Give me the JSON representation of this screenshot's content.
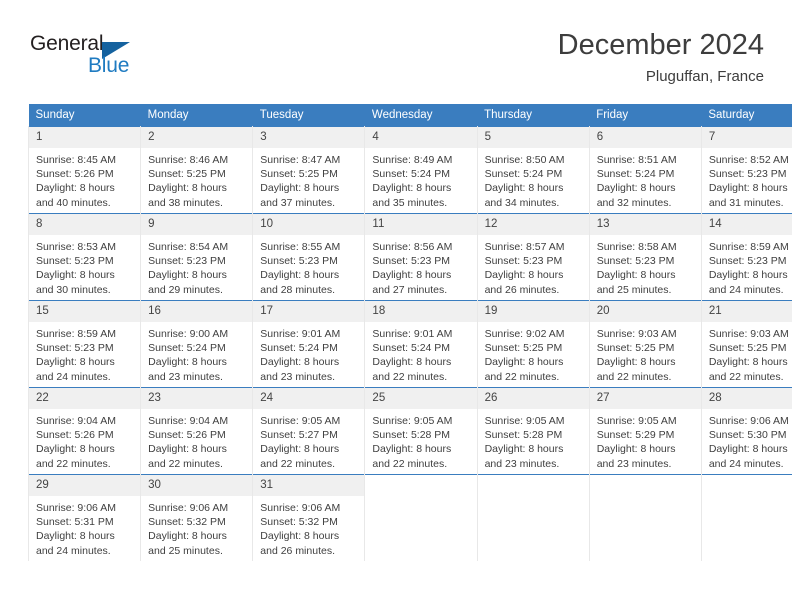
{
  "brand": {
    "name_part1": "General",
    "name_part2": "Blue",
    "triangle_color": "#15629f",
    "blue_color": "#1f7bc1"
  },
  "header": {
    "title": "December 2024",
    "location": "Pluguffan, France"
  },
  "theme": {
    "header_bg": "#3a7dbf",
    "daynum_bg": "#f0f0f0",
    "text_color": "#3f3f3f"
  },
  "weekdays": [
    "Sunday",
    "Monday",
    "Tuesday",
    "Wednesday",
    "Thursday",
    "Friday",
    "Saturday"
  ],
  "labels": {
    "sunrise_prefix": "Sunrise: ",
    "sunset_prefix": "Sunset: ",
    "daylight_prefix": "Daylight: "
  },
  "weeks": [
    [
      {
        "day": "1",
        "sunrise": "Sunrise: 8:45 AM",
        "sunset": "Sunset: 5:26 PM",
        "daylight_line1": "Daylight: 8 hours",
        "daylight_line2": "and 40 minutes."
      },
      {
        "day": "2",
        "sunrise": "Sunrise: 8:46 AM",
        "sunset": "Sunset: 5:25 PM",
        "daylight_line1": "Daylight: 8 hours",
        "daylight_line2": "and 38 minutes."
      },
      {
        "day": "3",
        "sunrise": "Sunrise: 8:47 AM",
        "sunset": "Sunset: 5:25 PM",
        "daylight_line1": "Daylight: 8 hours",
        "daylight_line2": "and 37 minutes."
      },
      {
        "day": "4",
        "sunrise": "Sunrise: 8:49 AM",
        "sunset": "Sunset: 5:24 PM",
        "daylight_line1": "Daylight: 8 hours",
        "daylight_line2": "and 35 minutes."
      },
      {
        "day": "5",
        "sunrise": "Sunrise: 8:50 AM",
        "sunset": "Sunset: 5:24 PM",
        "daylight_line1": "Daylight: 8 hours",
        "daylight_line2": "and 34 minutes."
      },
      {
        "day": "6",
        "sunrise": "Sunrise: 8:51 AM",
        "sunset": "Sunset: 5:24 PM",
        "daylight_line1": "Daylight: 8 hours",
        "daylight_line2": "and 32 minutes."
      },
      {
        "day": "7",
        "sunrise": "Sunrise: 8:52 AM",
        "sunset": "Sunset: 5:23 PM",
        "daylight_line1": "Daylight: 8 hours",
        "daylight_line2": "and 31 minutes."
      }
    ],
    [
      {
        "day": "8",
        "sunrise": "Sunrise: 8:53 AM",
        "sunset": "Sunset: 5:23 PM",
        "daylight_line1": "Daylight: 8 hours",
        "daylight_line2": "and 30 minutes."
      },
      {
        "day": "9",
        "sunrise": "Sunrise: 8:54 AM",
        "sunset": "Sunset: 5:23 PM",
        "daylight_line1": "Daylight: 8 hours",
        "daylight_line2": "and 29 minutes."
      },
      {
        "day": "10",
        "sunrise": "Sunrise: 8:55 AM",
        "sunset": "Sunset: 5:23 PM",
        "daylight_line1": "Daylight: 8 hours",
        "daylight_line2": "and 28 minutes."
      },
      {
        "day": "11",
        "sunrise": "Sunrise: 8:56 AM",
        "sunset": "Sunset: 5:23 PM",
        "daylight_line1": "Daylight: 8 hours",
        "daylight_line2": "and 27 minutes."
      },
      {
        "day": "12",
        "sunrise": "Sunrise: 8:57 AM",
        "sunset": "Sunset: 5:23 PM",
        "daylight_line1": "Daylight: 8 hours",
        "daylight_line2": "and 26 minutes."
      },
      {
        "day": "13",
        "sunrise": "Sunrise: 8:58 AM",
        "sunset": "Sunset: 5:23 PM",
        "daylight_line1": "Daylight: 8 hours",
        "daylight_line2": "and 25 minutes."
      },
      {
        "day": "14",
        "sunrise": "Sunrise: 8:59 AM",
        "sunset": "Sunset: 5:23 PM",
        "daylight_line1": "Daylight: 8 hours",
        "daylight_line2": "and 24 minutes."
      }
    ],
    [
      {
        "day": "15",
        "sunrise": "Sunrise: 8:59 AM",
        "sunset": "Sunset: 5:23 PM",
        "daylight_line1": "Daylight: 8 hours",
        "daylight_line2": "and 24 minutes."
      },
      {
        "day": "16",
        "sunrise": "Sunrise: 9:00 AM",
        "sunset": "Sunset: 5:24 PM",
        "daylight_line1": "Daylight: 8 hours",
        "daylight_line2": "and 23 minutes."
      },
      {
        "day": "17",
        "sunrise": "Sunrise: 9:01 AM",
        "sunset": "Sunset: 5:24 PM",
        "daylight_line1": "Daylight: 8 hours",
        "daylight_line2": "and 23 minutes."
      },
      {
        "day": "18",
        "sunrise": "Sunrise: 9:01 AM",
        "sunset": "Sunset: 5:24 PM",
        "daylight_line1": "Daylight: 8 hours",
        "daylight_line2": "and 22 minutes."
      },
      {
        "day": "19",
        "sunrise": "Sunrise: 9:02 AM",
        "sunset": "Sunset: 5:25 PM",
        "daylight_line1": "Daylight: 8 hours",
        "daylight_line2": "and 22 minutes."
      },
      {
        "day": "20",
        "sunrise": "Sunrise: 9:03 AM",
        "sunset": "Sunset: 5:25 PM",
        "daylight_line1": "Daylight: 8 hours",
        "daylight_line2": "and 22 minutes."
      },
      {
        "day": "21",
        "sunrise": "Sunrise: 9:03 AM",
        "sunset": "Sunset: 5:25 PM",
        "daylight_line1": "Daylight: 8 hours",
        "daylight_line2": "and 22 minutes."
      }
    ],
    [
      {
        "day": "22",
        "sunrise": "Sunrise: 9:04 AM",
        "sunset": "Sunset: 5:26 PM",
        "daylight_line1": "Daylight: 8 hours",
        "daylight_line2": "and 22 minutes."
      },
      {
        "day": "23",
        "sunrise": "Sunrise: 9:04 AM",
        "sunset": "Sunset: 5:26 PM",
        "daylight_line1": "Daylight: 8 hours",
        "daylight_line2": "and 22 minutes."
      },
      {
        "day": "24",
        "sunrise": "Sunrise: 9:05 AM",
        "sunset": "Sunset: 5:27 PM",
        "daylight_line1": "Daylight: 8 hours",
        "daylight_line2": "and 22 minutes."
      },
      {
        "day": "25",
        "sunrise": "Sunrise: 9:05 AM",
        "sunset": "Sunset: 5:28 PM",
        "daylight_line1": "Daylight: 8 hours",
        "daylight_line2": "and 22 minutes."
      },
      {
        "day": "26",
        "sunrise": "Sunrise: 9:05 AM",
        "sunset": "Sunset: 5:28 PM",
        "daylight_line1": "Daylight: 8 hours",
        "daylight_line2": "and 23 minutes."
      },
      {
        "day": "27",
        "sunrise": "Sunrise: 9:05 AM",
        "sunset": "Sunset: 5:29 PM",
        "daylight_line1": "Daylight: 8 hours",
        "daylight_line2": "and 23 minutes."
      },
      {
        "day": "28",
        "sunrise": "Sunrise: 9:06 AM",
        "sunset": "Sunset: 5:30 PM",
        "daylight_line1": "Daylight: 8 hours",
        "daylight_line2": "and 24 minutes."
      }
    ],
    [
      {
        "day": "29",
        "sunrise": "Sunrise: 9:06 AM",
        "sunset": "Sunset: 5:31 PM",
        "daylight_line1": "Daylight: 8 hours",
        "daylight_line2": "and 24 minutes."
      },
      {
        "day": "30",
        "sunrise": "Sunrise: 9:06 AM",
        "sunset": "Sunset: 5:32 PM",
        "daylight_line1": "Daylight: 8 hours",
        "daylight_line2": "and 25 minutes."
      },
      {
        "day": "31",
        "sunrise": "Sunrise: 9:06 AM",
        "sunset": "Sunset: 5:32 PM",
        "daylight_line1": "Daylight: 8 hours",
        "daylight_line2": "and 26 minutes."
      },
      {
        "day": "",
        "sunrise": "",
        "sunset": "",
        "daylight_line1": "",
        "daylight_line2": ""
      },
      {
        "day": "",
        "sunrise": "",
        "sunset": "",
        "daylight_line1": "",
        "daylight_line2": ""
      },
      {
        "day": "",
        "sunrise": "",
        "sunset": "",
        "daylight_line1": "",
        "daylight_line2": ""
      },
      {
        "day": "",
        "sunrise": "",
        "sunset": "",
        "daylight_line1": "",
        "daylight_line2": ""
      }
    ]
  ]
}
